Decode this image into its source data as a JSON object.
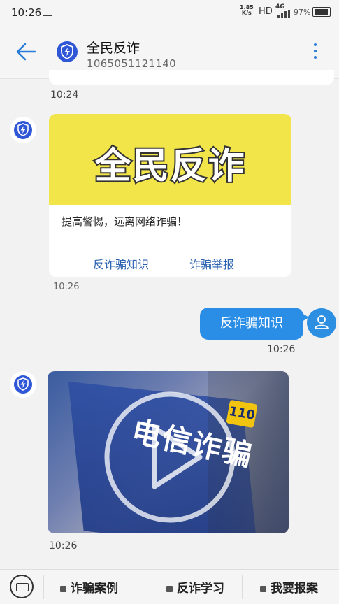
{
  "status_bar": {
    "time": "10:26",
    "net_speed": "1.85",
    "net_unit": "K/s",
    "hd": "HD",
    "network": "4G",
    "battery": "97%"
  },
  "header": {
    "title": "全民反诈",
    "subtitle": "1065051121140"
  },
  "messages": {
    "prev_time": "10:24",
    "card": {
      "banner_text": "全民反诈",
      "description": "提高警惕，远离网络诈骗！",
      "link_1": "反诈骗知识",
      "link_2": "诈骗举报",
      "time": "10:26"
    },
    "outgoing": {
      "text": "反诈骗知识",
      "time": "10:26"
    },
    "video": {
      "sign_text": "电信诈骗",
      "badge": "110",
      "time": "10:26"
    }
  },
  "bottom_menu": {
    "item_1": "诈骗案例",
    "item_2": "反诈学习",
    "item_3": "我要报案"
  },
  "colors": {
    "accent": "#2b8ee6",
    "link": "#2b62b0",
    "banner": "#f2e54a"
  }
}
